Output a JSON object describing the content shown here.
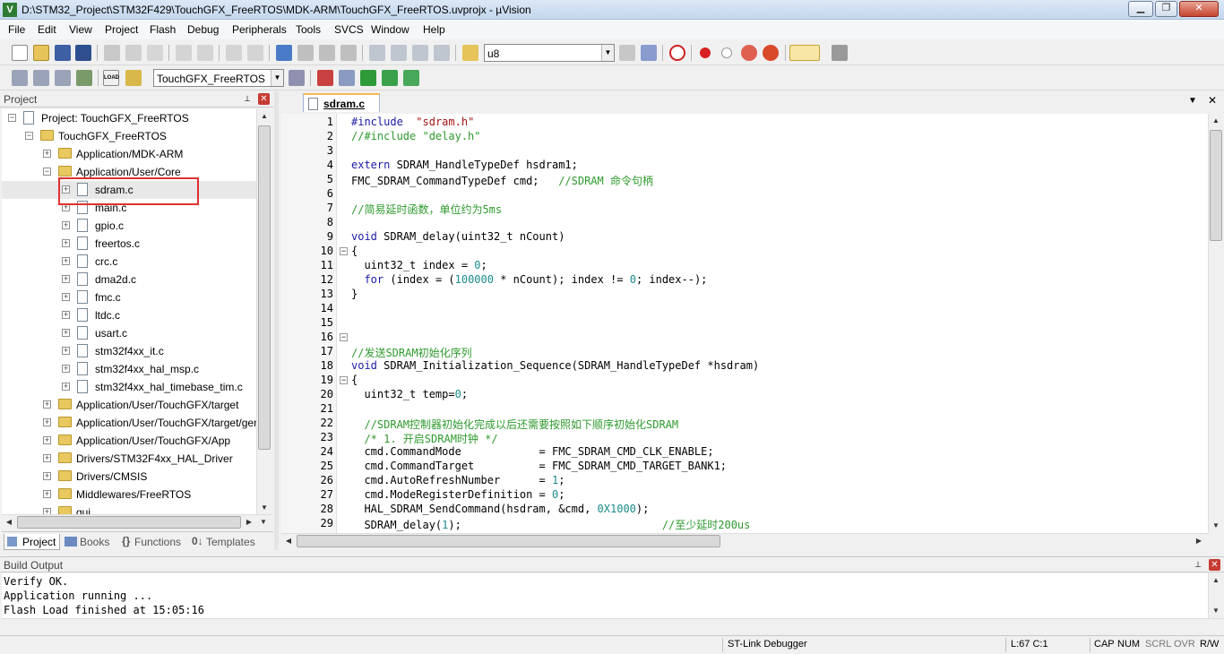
{
  "window": {
    "title": "D:\\STM32_Project\\STM32F429\\TouchGFX_FreeRTOS\\MDK-ARM\\TouchGFX_FreeRTOS.uvprojx - µVision",
    "minimize": "▁",
    "restore": "❐",
    "close": "✕"
  },
  "menu": [
    "File",
    "Edit",
    "View",
    "Project",
    "Flash",
    "Debug",
    "Peripherals",
    "Tools",
    "SVCS",
    "Window",
    "Help"
  ],
  "toolbar": {
    "find_value": "u8",
    "target_value": "TouchGFX_FreeRTOS",
    "load_label": "LOAD"
  },
  "project_panel": {
    "title": "Project",
    "pin": "⊥",
    "close": "✕",
    "root": "Project: TouchGFX_FreeRTOS",
    "target": "TouchGFX_FreeRTOS",
    "groups_before": [
      "Application/MDK-ARM",
      "Application/User/Core"
    ],
    "files": [
      "sdram.c",
      "main.c",
      "gpio.c",
      "freertos.c",
      "crc.c",
      "dma2d.c",
      "fmc.c",
      "ltdc.c",
      "usart.c",
      "stm32f4xx_it.c",
      "stm32f4xx_hal_msp.c",
      "stm32f4xx_hal_timebase_tim.c"
    ],
    "groups_after": [
      "Application/User/TouchGFX/target",
      "Application/User/TouchGFX/target/generated",
      "Application/User/TouchGFX/App",
      "Drivers/STM32F4xx_HAL_Driver",
      "Drivers/CMSIS",
      "Middlewares/FreeRTOS",
      "gui"
    ],
    "tabs": [
      "Project",
      "Books",
      "Functions",
      "Templates"
    ]
  },
  "editor": {
    "tab_label": "sdram.c",
    "lines": [
      {
        "n": "1",
        "t": [
          [
            "kw",
            "#include "
          ],
          [
            "str",
            "\"sdram.h\""
          ]
        ]
      },
      {
        "n": "2",
        "t": [
          [
            "cm",
            "//#include \"delay.h\""
          ]
        ]
      },
      {
        "n": "3",
        "t": []
      },
      {
        "n": "4",
        "t": [
          [
            "kw",
            "extern"
          ],
          [
            "",
            "SDRAM_HandleTypeDef hsdram1;"
          ]
        ]
      },
      {
        "n": "5",
        "t": [
          [
            "",
            "FMC_SDRAM_CommandTypeDef cmd;   "
          ],
          [
            "cm",
            "//SDRAM 命令句柄"
          ]
        ]
      },
      {
        "n": "6",
        "t": []
      },
      {
        "n": "7",
        "t": [
          [
            "cm",
            "//简易延时函数，单位约为5ms"
          ]
        ]
      },
      {
        "n": "8",
        "t": []
      },
      {
        "n": "9",
        "t": [
          [
            "kw",
            "void"
          ],
          [
            "",
            "SDRAM_delay(uint32_t nCount)"
          ]
        ]
      },
      {
        "n": "10",
        "t": [
          [
            "",
            "{"
          ]
        ],
        "fold": true
      },
      {
        "n": "11",
        "t": [
          [
            "",
            "  uint32_t index = "
          ],
          [
            "num",
            "0"
          ],
          [
            "",
            ";"
          ]
        ]
      },
      {
        "n": "12",
        "t": [
          [
            "",
            "  "
          ],
          [
            "kw",
            "for"
          ],
          [
            "",
            "(index = ("
          ],
          [
            "num",
            "100000"
          ],
          [
            "",
            " * nCount); index != "
          ],
          [
            "num",
            "0"
          ],
          [
            "",
            "; index--);"
          ]
        ]
      },
      {
        "n": "13",
        "t": [
          [
            "",
            "}"
          ]
        ]
      },
      {
        "n": "14",
        "t": []
      },
      {
        "n": "15",
        "t": []
      },
      {
        "n": "16",
        "t": [],
        "fold": true
      },
      {
        "n": "17",
        "t": [
          [
            "cm",
            "//发送SDRAM初始化序列"
          ]
        ]
      },
      {
        "n": "18",
        "t": [
          [
            "kw",
            "void"
          ],
          [
            "",
            "SDRAM_Initialization_Sequence(SDRAM_HandleTypeDef *hsdram)"
          ]
        ]
      },
      {
        "n": "19",
        "t": [
          [
            "",
            "{"
          ]
        ],
        "fold": true
      },
      {
        "n": "20",
        "t": [
          [
            "",
            "  uint32_t temp="
          ],
          [
            "num",
            "0"
          ],
          [
            "",
            ";"
          ]
        ]
      },
      {
        "n": "21",
        "t": []
      },
      {
        "n": "22",
        "t": [
          [
            "",
            "  "
          ],
          [
            "cm",
            "//SDRAM控制器初始化完成以后还需要按照如下顺序初始化SDRAM"
          ]
        ]
      },
      {
        "n": "23",
        "t": [
          [
            "",
            "  "
          ],
          [
            "cm",
            "/* 1. 开启SDRAM时钟 */"
          ]
        ]
      },
      {
        "n": "24",
        "t": [
          [
            "",
            "  cmd.CommandMode            = FMC_SDRAM_CMD_CLK_ENABLE;"
          ]
        ]
      },
      {
        "n": "25",
        "t": [
          [
            "",
            "  cmd.CommandTarget          = FMC_SDRAM_CMD_TARGET_BANK1;"
          ]
        ]
      },
      {
        "n": "26",
        "t": [
          [
            "",
            "  cmd.AutoRefreshNumber      = "
          ],
          [
            "num",
            "1"
          ],
          [
            "",
            ";"
          ]
        ]
      },
      {
        "n": "27",
        "t": [
          [
            "",
            "  cmd.ModeRegisterDefinition = "
          ],
          [
            "num",
            "0"
          ],
          [
            "",
            ";"
          ]
        ]
      },
      {
        "n": "28",
        "t": [
          [
            "",
            "  HAL_SDRAM_SendCommand(hsdram, &cmd, "
          ],
          [
            "num",
            "0X1000"
          ],
          [
            "",
            ");"
          ]
        ]
      },
      {
        "n": "29",
        "t": [
          [
            "",
            "  SDRAM_delay("
          ],
          [
            "num",
            "1"
          ],
          [
            "",
            ");                               "
          ],
          [
            "cm",
            "//至少延时200us"
          ]
        ]
      }
    ]
  },
  "build_output": {
    "title": "Build Output",
    "lines": [
      "Verify OK.",
      "Application running ...",
      "Flash Load finished at 15:05:16"
    ]
  },
  "status": {
    "debugger": "ST-Link Debugger",
    "position": "L:67 C:1",
    "caps": "CAP",
    "num": "NUM",
    "scrl": "SCRL",
    "ovr": "OVR",
    "rw": "R/W"
  },
  "colors": {
    "keyword": "#1a1aa6",
    "string": "#a31515",
    "comment": "#2e9a2e",
    "number": "#1a8a8a",
    "highlight_box": "#e03030"
  }
}
